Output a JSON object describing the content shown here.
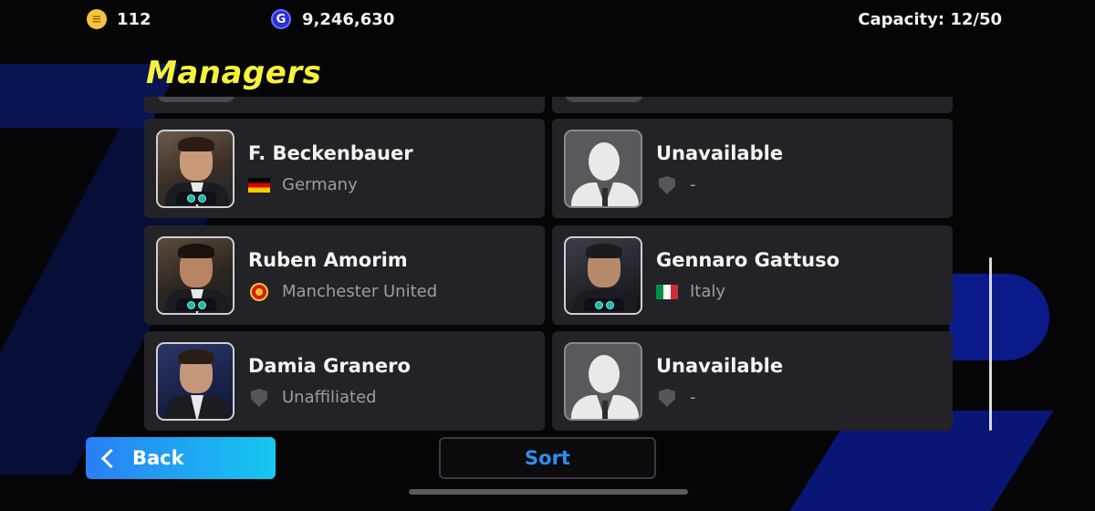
{
  "topbar": {
    "efootball_coins": "112",
    "gp": "9,246,630",
    "capacity": "Capacity: 12/50"
  },
  "title": "Managers",
  "managers": [
    {
      "name": "F. Beckenbauer",
      "affiliation": "Germany",
      "affiliation_icon": "germany-flag-icon",
      "available": true
    },
    {
      "name": "Unavailable",
      "affiliation": "-",
      "affiliation_icon": "shield-icon",
      "available": false
    },
    {
      "name": "Ruben Amorim",
      "affiliation": "Manchester United",
      "affiliation_icon": "manchester-united-crest-icon",
      "available": true
    },
    {
      "name": "Gennaro Gattuso",
      "affiliation": "Italy",
      "affiliation_icon": "italy-flag-icon",
      "available": true
    },
    {
      "name": "Damia Granero",
      "affiliation": "Unaffiliated",
      "affiliation_icon": "shield-icon",
      "available": true
    },
    {
      "name": "Unavailable",
      "affiliation": "-",
      "affiliation_icon": "shield-icon",
      "available": false
    }
  ],
  "buttons": {
    "back": "Back",
    "sort": "Sort"
  },
  "colors": {
    "title": "#f6f33a",
    "card": "#232327",
    "back_gradient_start": "#2a7ff5",
    "back_gradient_end": "#16c8f0",
    "sort_text": "#2f8ff0"
  }
}
